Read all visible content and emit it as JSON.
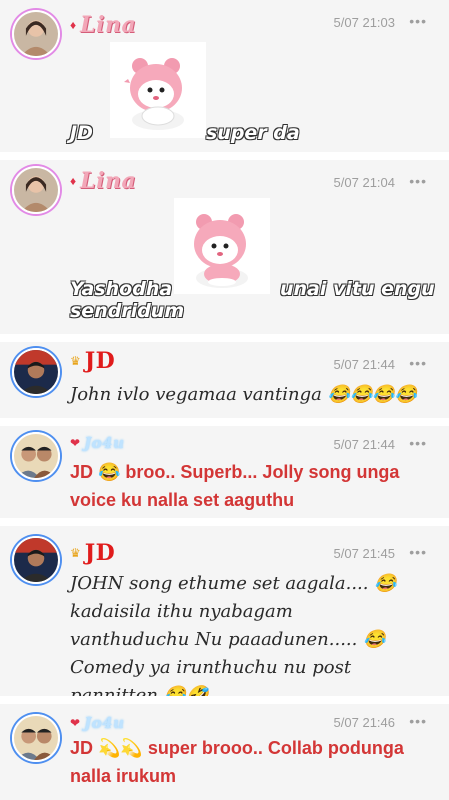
{
  "posts": [
    {
      "username": "Lina",
      "timestamp": "5/07 21:03",
      "more_label": "•••",
      "badge": "♦",
      "text_left": "JD",
      "text_right": "super da",
      "sticker_icon": "pink-bear-sticker"
    },
    {
      "username": "Lina",
      "timestamp": "5/07 21:04",
      "more_label": "•••",
      "badge": "♦",
      "text_left": "Yashodha",
      "text_right": "unai vitu engu",
      "text_bottom": "sendridum",
      "sticker_icon": "pink-bear-sticker"
    },
    {
      "username": "JD",
      "timestamp": "5/07 21:44",
      "more_label": "•••",
      "badge": "♛",
      "text": "John ivlo vegamaa vantinga 😂😂😂😂"
    },
    {
      "username": "Jo4u",
      "timestamp": "5/07 21:44",
      "more_label": "•••",
      "badge": "❤",
      "text": "JD 😂 broo.. Superb... Jolly song unga voice ku nalla set aaguthu"
    },
    {
      "username": "JD",
      "timestamp": "5/07 21:45",
      "more_label": "•••",
      "badge": "♛",
      "text": "JOHN song ethume set aagala.... 😂 kadaisila ithu nyabagam vanthuduchu Nu paaadunen..... 😂Comedy ya irunthuchu nu post pannitten 😂🤣"
    },
    {
      "username": "Jo4u",
      "timestamp": "5/07 21:46",
      "more_label": "•••",
      "badge": "❤",
      "text": "JD 💫💫 super brooo.. Collab podunga nalla irukum"
    }
  ],
  "colors": {
    "lina_name": "#f2a7b8",
    "jd_name": "#e01b1b",
    "red_text": "#d33636",
    "background": "#f5f5f5",
    "timestamp": "#9e9e9e"
  }
}
